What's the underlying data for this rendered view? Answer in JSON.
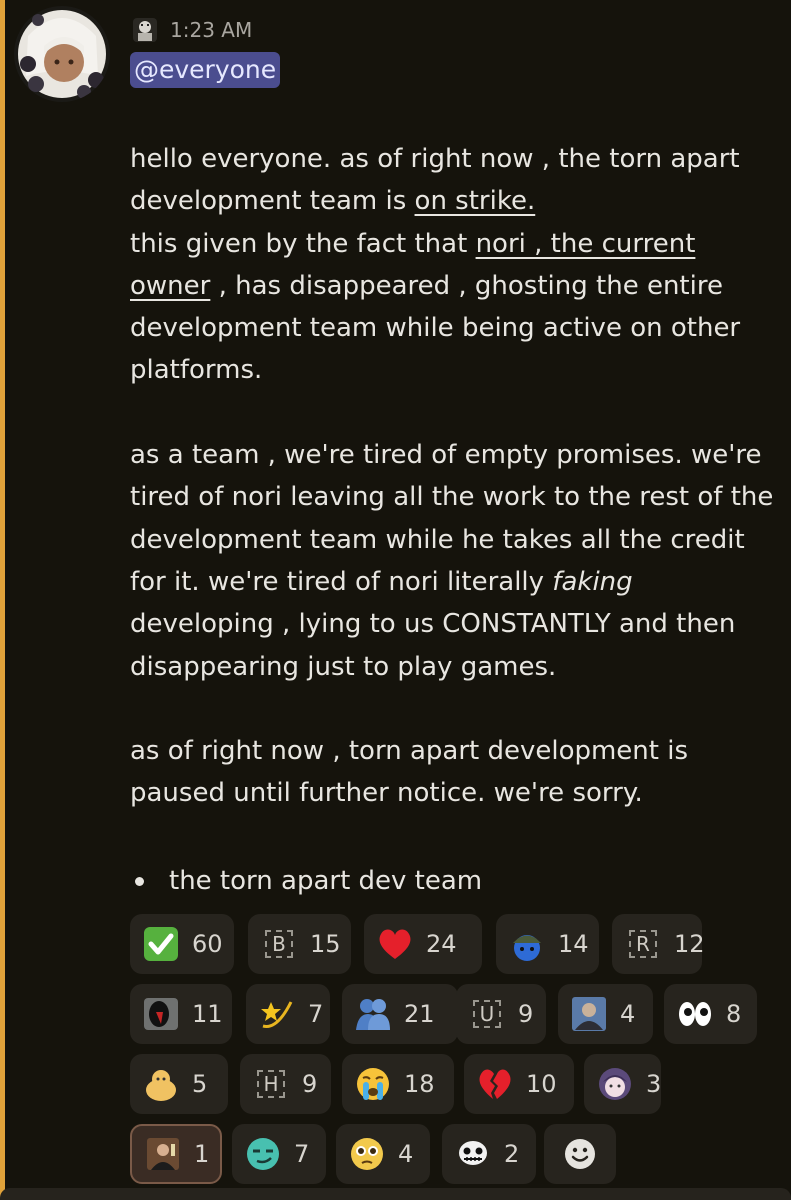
{
  "message": {
    "timestamp": "1:23 AM",
    "mention": "@everyone",
    "p1": {
      "a": "hello everyone. as of right now , the torn apart development team is ",
      "b": "on strike."
    },
    "p2": {
      "a": "this given by the fact that ",
      "b": "nori , the current owner",
      "c": " , has disappeared , ghosting the entire development team while being active on other platforms."
    },
    "p3": {
      "a": "as a team , we're tired of empty promises. we're tired of nori leaving all the work to the rest of the development team while he takes all the credit for it. we're tired of nori literally ",
      "b": "faking",
      "c": " developing , lying to us CONSTANTLY and then disappearing just to play games."
    },
    "p4": "as of right now , torn apart development is paused until further notice. we're sorry.",
    "bullet": "the torn apart dev team"
  },
  "reactions": [
    {
      "emoji": "check-mark-icon",
      "count": "60"
    },
    {
      "emoji": "custom-b-icon",
      "letter": "B",
      "count": "15"
    },
    {
      "emoji": "red-heart-icon",
      "count": "24"
    },
    {
      "emoji": "soldier-blob-icon",
      "count": "14"
    },
    {
      "emoji": "custom-r-icon",
      "letter": "R",
      "count": "12"
    },
    {
      "emoji": "dark-mask-icon",
      "count": "11"
    },
    {
      "emoji": "dizzy-star-icon",
      "count": "7"
    },
    {
      "emoji": "hugging-people-icon",
      "count": "21"
    },
    {
      "emoji": "custom-u-icon",
      "letter": "U",
      "count": "9"
    },
    {
      "emoji": "photo-person-icon",
      "count": "4"
    },
    {
      "emoji": "eyes-icon",
      "count": "8"
    },
    {
      "emoji": "yellow-blob-icon",
      "count": "5"
    },
    {
      "emoji": "custom-h-icon",
      "letter": "H",
      "count": "9"
    },
    {
      "emoji": "crying-face-icon",
      "count": "18"
    },
    {
      "emoji": "broken-heart-icon",
      "count": "10"
    },
    {
      "emoji": "anime-girl-icon",
      "count": "3"
    },
    {
      "emoji": "toast-man-icon",
      "count": "1"
    },
    {
      "emoji": "smirk-face-icon",
      "count": "7"
    },
    {
      "emoji": "pleading-face-icon",
      "count": "4"
    },
    {
      "emoji": "sans-skull-icon",
      "count": "2"
    }
  ],
  "add_reaction": "add-reaction-icon",
  "colors": {
    "background": "#15130c",
    "accent": "#e0a23a",
    "mention_bg": "#4b4d8f",
    "reaction_bg": "#27241e"
  }
}
